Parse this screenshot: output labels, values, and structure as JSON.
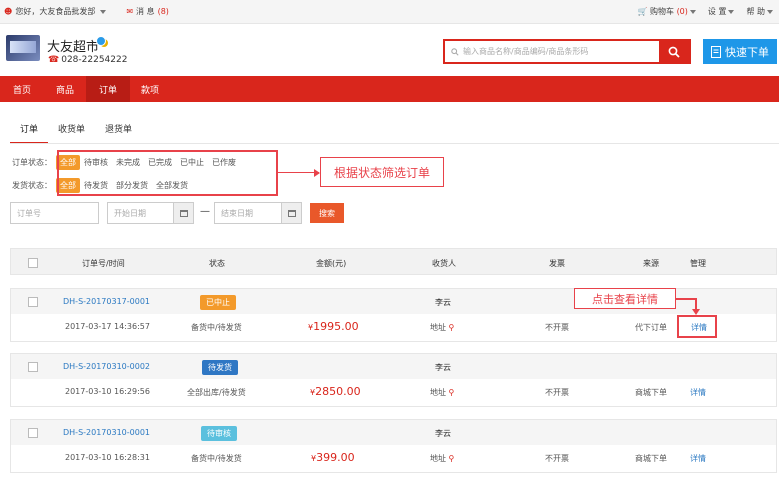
{
  "topbar": {
    "greeting": "您好，大友食品批发部",
    "messages_label": "消 息",
    "messages_count": "(8)",
    "cart_label": "购物车",
    "cart_count": "(0)",
    "settings_label": "设 置",
    "help_label": "帮 助"
  },
  "header": {
    "store_name": "大友超市",
    "phone": "028-22254222",
    "search_placeholder": "输入商品名称/商品编码/商品条形码",
    "quick_order_label": "快速下单"
  },
  "nav": {
    "items": [
      {
        "label": "首页"
      },
      {
        "label": "商品"
      },
      {
        "label": "订单",
        "active": true
      },
      {
        "label": "款项"
      }
    ]
  },
  "tabs": [
    {
      "label": "订单",
      "active": true
    },
    {
      "label": "收货单"
    },
    {
      "label": "退货单"
    }
  ],
  "filters": {
    "order_status_label": "订单状态：",
    "order_status_options": [
      "全部",
      "待审核",
      "未完成",
      "已完成",
      "已中止",
      "已作废"
    ],
    "ship_status_label": "发货状态：",
    "ship_status_options": [
      "全部",
      "待发货",
      "部分发货",
      "全部发货"
    ],
    "order_no_placeholder": "订单号",
    "start_date_placeholder": "开始日期",
    "end_date_placeholder": "结束日期",
    "date_separator": "—",
    "search_label": "搜索"
  },
  "annotations": {
    "filter_callout": "根据状态筛选订单",
    "detail_callout": "点击查看详情"
  },
  "table": {
    "headers": [
      "订单号/时间",
      "状态",
      "金额(元)",
      "收货人",
      "发票",
      "来源",
      "管理"
    ],
    "orders": [
      {
        "no": "DH-S-20170317-0001",
        "status": "已中止",
        "status_color": "#f39a2b",
        "receiver": "李云",
        "time": "2017-03-17 14:36:57",
        "sub_status": "备货中/待发货",
        "amount": "1995.00",
        "address": "地址",
        "invoice": "不开票",
        "source": "代下订单",
        "action": "详情"
      },
      {
        "no": "DH-S-20170310-0002",
        "status": "待发货",
        "status_color": "#2f77c4",
        "receiver": "李云",
        "time": "2017-03-10 16:29:56",
        "sub_status": "全部出库/待发货",
        "amount": "2850.00",
        "address": "地址",
        "invoice": "不开票",
        "source": "商城下单",
        "action": "详情"
      },
      {
        "no": "DH-S-20170310-0001",
        "status": "待审核",
        "status_color": "#5bc0de",
        "receiver": "李云",
        "time": "2017-03-10 16:28:31",
        "sub_status": "备货中/待发货",
        "amount": "399.00",
        "address": "地址",
        "invoice": "不开票",
        "source": "商城下单",
        "action": "详情"
      }
    ],
    "currency": "¥"
  },
  "colors": {
    "brand_red": "#d9261c",
    "accent_orange": "#f39a2b",
    "link_blue": "#2b79c2",
    "annotation_red": "#e8424a"
  }
}
